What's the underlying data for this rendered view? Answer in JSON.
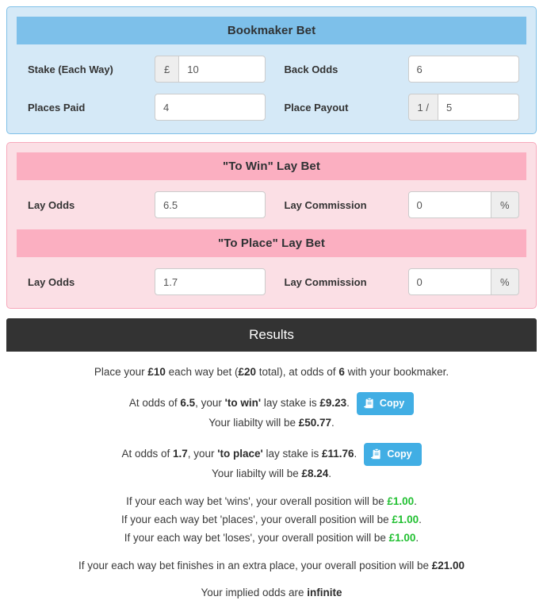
{
  "bookmaker": {
    "title": "Bookmaker Bet",
    "fields": [
      {
        "label": "Stake (Each Way)",
        "prefix": "£",
        "value": "10",
        "suffix": ""
      },
      {
        "label": "Back Odds",
        "prefix": "",
        "value": "6",
        "suffix": ""
      },
      {
        "label": "Places Paid",
        "prefix": "",
        "value": "4",
        "suffix": ""
      },
      {
        "label": "Place Payout",
        "prefix": "1 /",
        "value": "5",
        "suffix": ""
      }
    ]
  },
  "lay_win": {
    "title": "\"To Win\" Lay Bet",
    "odds_label": "Lay Odds",
    "odds_value": "6.5",
    "commission_label": "Lay Commission",
    "commission_value": "0",
    "commission_suffix": "%"
  },
  "lay_place": {
    "title": "\"To Place\" Lay Bet",
    "odds_label": "Lay Odds",
    "odds_value": "1.7",
    "commission_label": "Lay Commission",
    "commission_value": "0",
    "commission_suffix": "%"
  },
  "results": {
    "title": "Results",
    "copy_label": "Copy",
    "place_line": {
      "pre": "Place your ",
      "stake": "£10",
      "mid1": " each way bet (",
      "total": "£20",
      "mid2": " total), at odds of ",
      "odds": "6",
      "post": " with your bookmaker."
    },
    "win_lay": {
      "pre": "At odds of ",
      "odds": "6.5",
      "mid": ", your ",
      "type": "'to win'",
      "mid2": " lay stake is ",
      "stake": "£9.23",
      "post": ".",
      "liability_pre": "Your liabilty will be ",
      "liability": "£50.77",
      "liability_post": "."
    },
    "place_lay": {
      "pre": "At odds of ",
      "odds": "1.7",
      "mid": ", your ",
      "type": "'to place'",
      "mid2": " lay stake is ",
      "stake": "£11.76",
      "post": ".",
      "liability_pre": "Your liabilty will be ",
      "liability": "£8.24",
      "liability_post": "."
    },
    "outcomes": [
      {
        "pre": "If your each way bet 'wins', your overall position will be ",
        "value": "£1.00",
        "post": "."
      },
      {
        "pre": "If your each way bet 'places', your overall position will be ",
        "value": "£1.00",
        "post": "."
      },
      {
        "pre": "If your each way bet 'loses', your overall position will be ",
        "value": "£1.00",
        "post": "."
      }
    ],
    "extra_place": {
      "pre": "If your each way bet finishes in an extra place, your overall position will be ",
      "value": "£21.00"
    },
    "implied": {
      "pre": "Your implied odds are ",
      "value": "infinite"
    }
  },
  "colors": {
    "blue_header": "#7dc0ea",
    "blue_body": "#d5e9f7",
    "pink_header": "#fbafc1",
    "pink_body": "#fbdfe5",
    "results_header": "#333333",
    "positive": "#22c032",
    "button": "#41aee4"
  }
}
